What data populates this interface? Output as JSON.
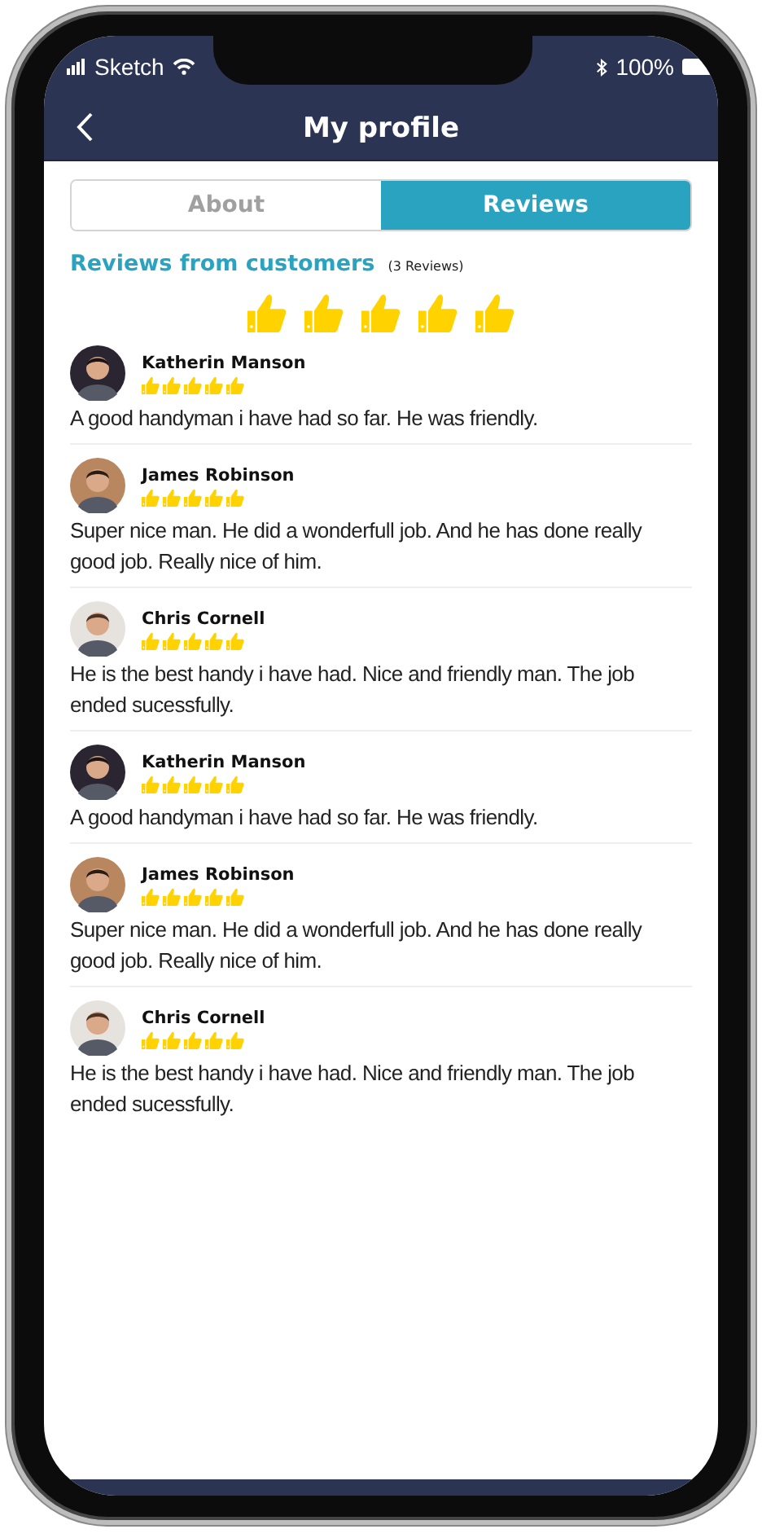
{
  "status_bar": {
    "carrier": "Sketch",
    "battery": "100%"
  },
  "header": {
    "title": "My profile"
  },
  "tabs": [
    {
      "label": "About",
      "selected": false
    },
    {
      "label": "Reviews",
      "selected": true
    }
  ],
  "reviews_section": {
    "title": "Reviews from customers",
    "count": "(3 Reviews)",
    "stars": 5
  },
  "reviews": [
    {
      "name": "Katherin Manson",
      "stars": 5,
      "text": "A good handyman i have had so far. He was friendly."
    },
    {
      "name": "James Robinson",
      "stars": 5,
      "text": "Super nice man. He did a wonderfull job. And he has done really good job. Really nice of him."
    },
    {
      "name": "Chris Cornell",
      "stars": 5,
      "text": "He is the best handy i have had. Nice and friendly man. The job ended sucessfully."
    },
    {
      "name": "Katherin Manson",
      "stars": 5,
      "text": "A good handyman i have had so far. He was friendly."
    },
    {
      "name": "James Robinson",
      "stars": 5,
      "text": "Super nice man. He did a wonderfull job. And he has done really good job. Really nice of him."
    },
    {
      "name": "Chris Cornell",
      "stars": 5,
      "text": "He is the best handy i have had. Nice and friendly man. The job ended sucessfully."
    }
  ]
}
